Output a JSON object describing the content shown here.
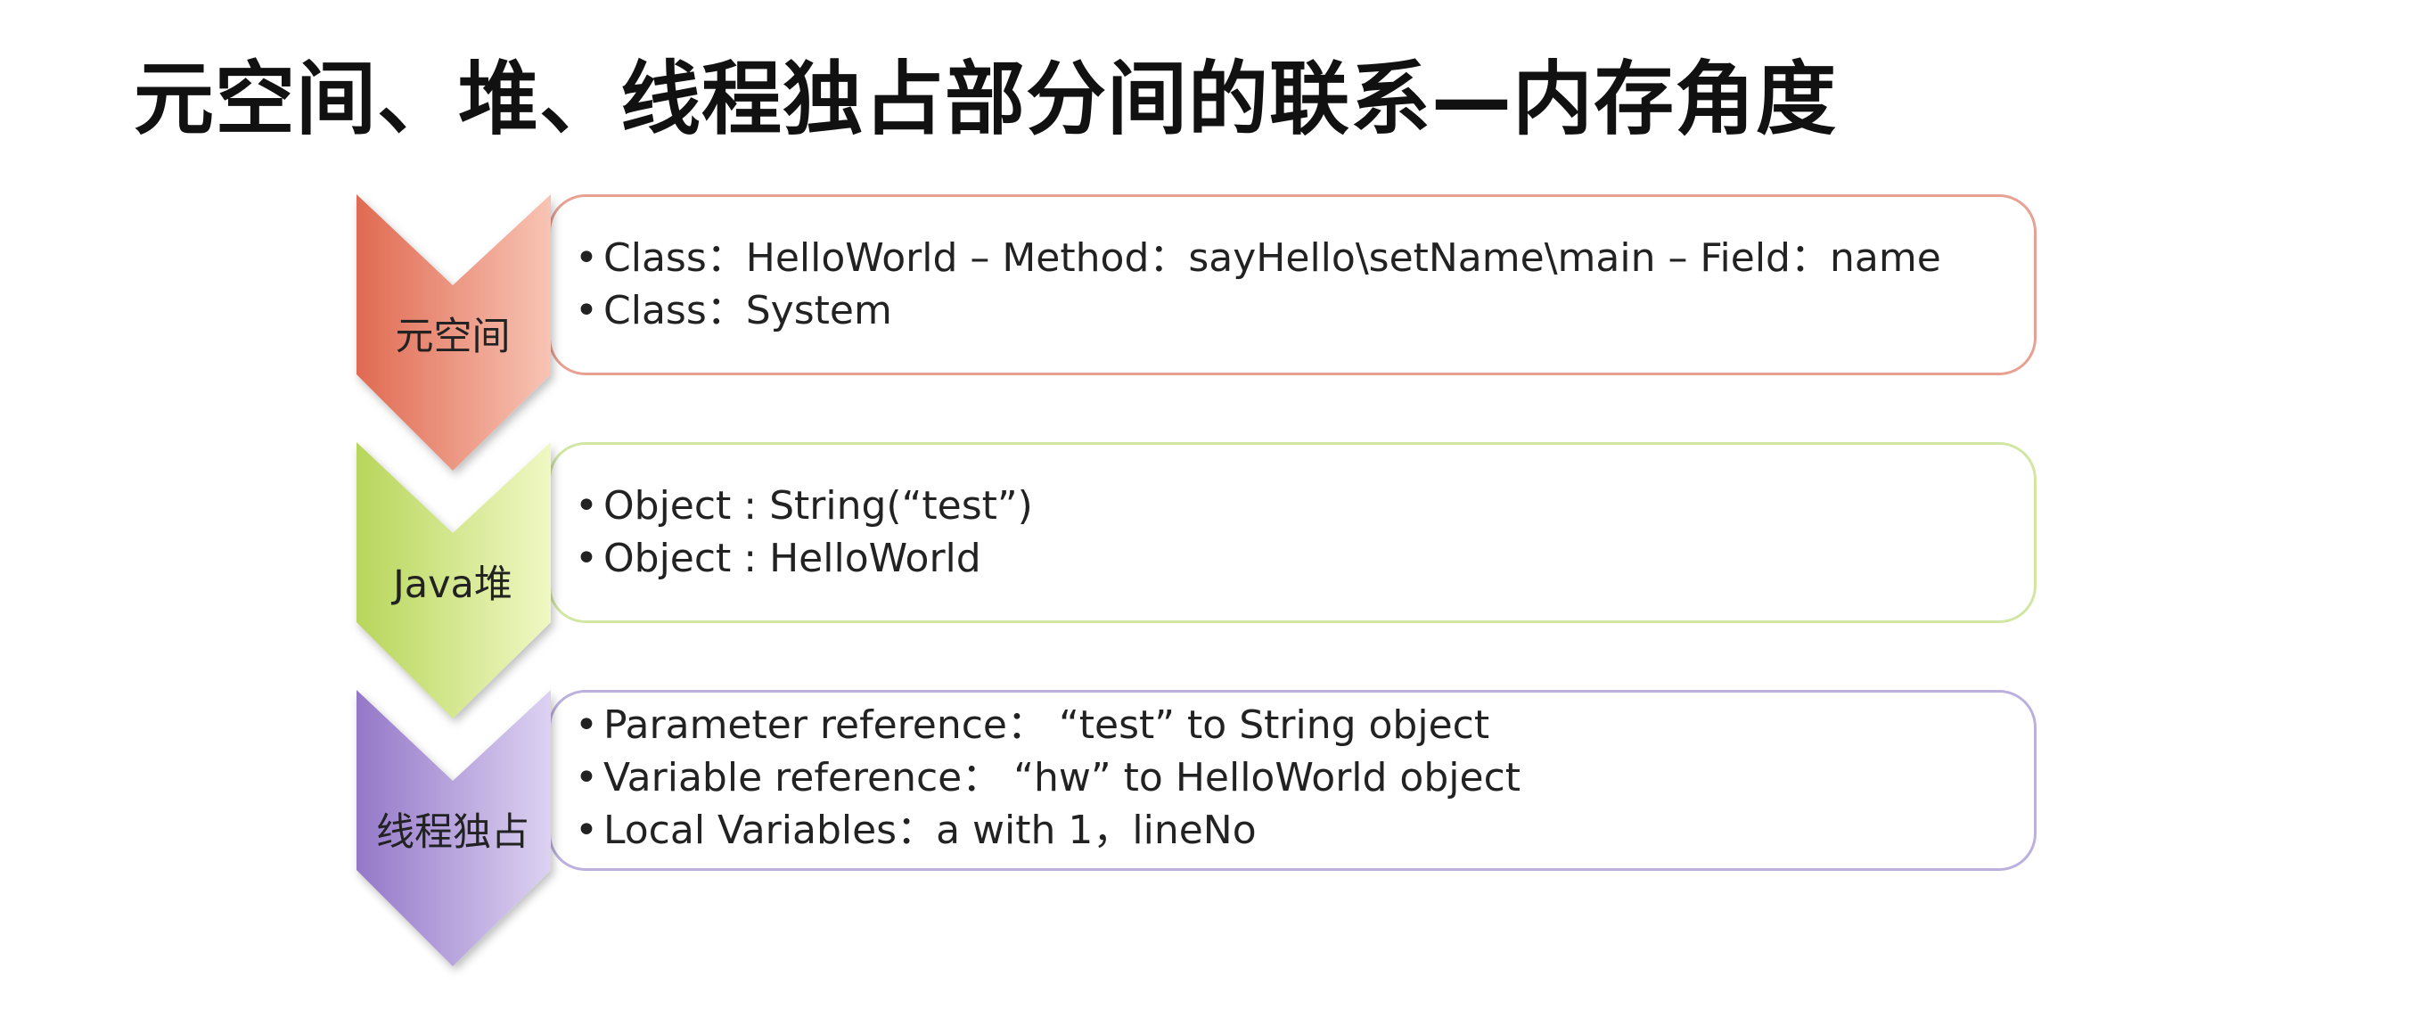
{
  "title": "元空间、堆、线程独占部分间的联系—内存角度",
  "rows": [
    {
      "label": "元空间",
      "color_dark": "#e06a52",
      "color_light": "#f6b5a3",
      "border": "#e8a092",
      "items": [
        "Class：HelloWorld – Method：sayHello\\setName\\main – Field：name",
        "Class：System"
      ]
    },
    {
      "label": "Java堆",
      "color_dark": "#b8d65b",
      "color_light": "#ecf6b8",
      "border": "#d2e6a4",
      "items": [
        "Object : String(“test”)",
        "Object : HelloWorld"
      ]
    },
    {
      "label": "线程独占",
      "color_dark": "#9478c8",
      "color_light": "#d8ccf0",
      "border": "#bcb0de",
      "items": [
        "Parameter reference： “test” to String object",
        "Variable reference： “hw”  to  HelloWorld object",
        "Local Variables：a with 1，lineNo"
      ]
    }
  ]
}
